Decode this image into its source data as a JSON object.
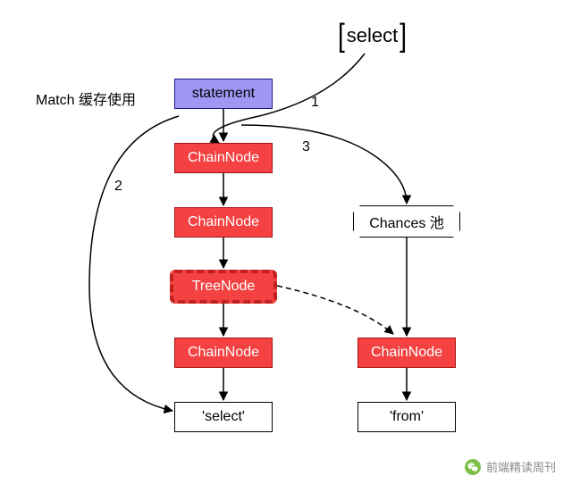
{
  "diagram": {
    "title_label": "Match 缓存使用",
    "input_token": "select",
    "statement": "statement",
    "chain_node_1": "ChainNode",
    "chain_node_2": "ChainNode",
    "tree_node": "TreeNode",
    "chain_node_3": "ChainNode",
    "chain_node_4": "ChainNode",
    "leaf_select": "'select'",
    "leaf_from": "'from'",
    "chances_pool": "Chances 池",
    "edge_1": "1",
    "edge_2": "2",
    "edge_3": "3"
  },
  "footer": {
    "text": "前端精读周刊"
  }
}
